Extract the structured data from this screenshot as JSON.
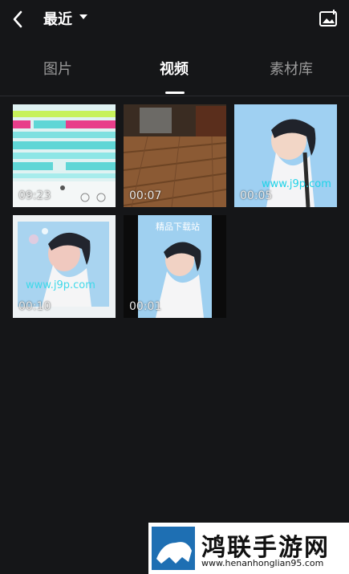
{
  "header": {
    "title": "最近",
    "back_icon": "chevron-left-icon",
    "caret_icon": "caret-down-icon",
    "right_icon": "image-add-icon"
  },
  "tabs": [
    {
      "label": "图片",
      "active": false
    },
    {
      "label": "视频",
      "active": true
    },
    {
      "label": "素材库",
      "active": false
    }
  ],
  "videos": [
    {
      "duration": "09:23"
    },
    {
      "duration": "00:07"
    },
    {
      "duration": "00:05",
      "overlay_text": "www.j9p.com"
    },
    {
      "duration": "00:10",
      "overlay_text": "www.j9p.com"
    },
    {
      "duration": "00:01",
      "overlay_text": "精品下载站"
    }
  ],
  "watermark": {
    "title": "鸿联手游网",
    "url": "www.henanhonglian95.com"
  },
  "colors": {
    "background": "#151618",
    "active_tab": "#ffffff",
    "inactive_tab": "#9a9a9a"
  }
}
